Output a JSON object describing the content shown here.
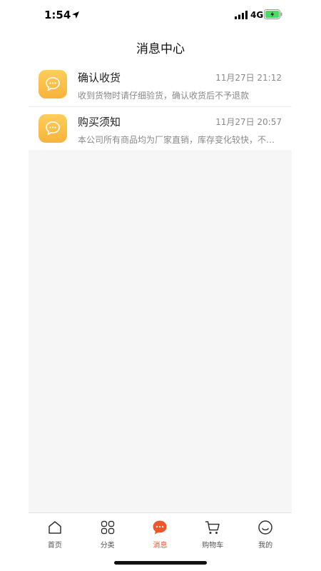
{
  "status_bar": {
    "time": "1:54",
    "network": "4G"
  },
  "header": {
    "title": "消息中心"
  },
  "messages": [
    {
      "title": "确认收货",
      "time": "11月27日 21:12",
      "preview": "收到货物时请仔细验货，确认收货后不予退款",
      "icon": "chat-bubble-icon"
    },
    {
      "title": "购买须知",
      "time": "11月27日 20:57",
      "preview": "本公司所有商品均为厂家直销，库存变化较快，不…",
      "icon": "chat-bubble-icon"
    }
  ],
  "tab_bar": {
    "items": [
      {
        "label": "首页",
        "icon": "home-icon",
        "active": false
      },
      {
        "label": "分类",
        "icon": "grid-icon",
        "active": false
      },
      {
        "label": "消息",
        "icon": "message-icon",
        "active": true
      },
      {
        "label": "购物车",
        "icon": "cart-icon",
        "active": false
      },
      {
        "label": "我的",
        "icon": "smile-icon",
        "active": false
      }
    ]
  },
  "colors": {
    "accent": "#f0552a",
    "avatar": "#f8bd45",
    "content_bg": "#f6f6f6"
  }
}
